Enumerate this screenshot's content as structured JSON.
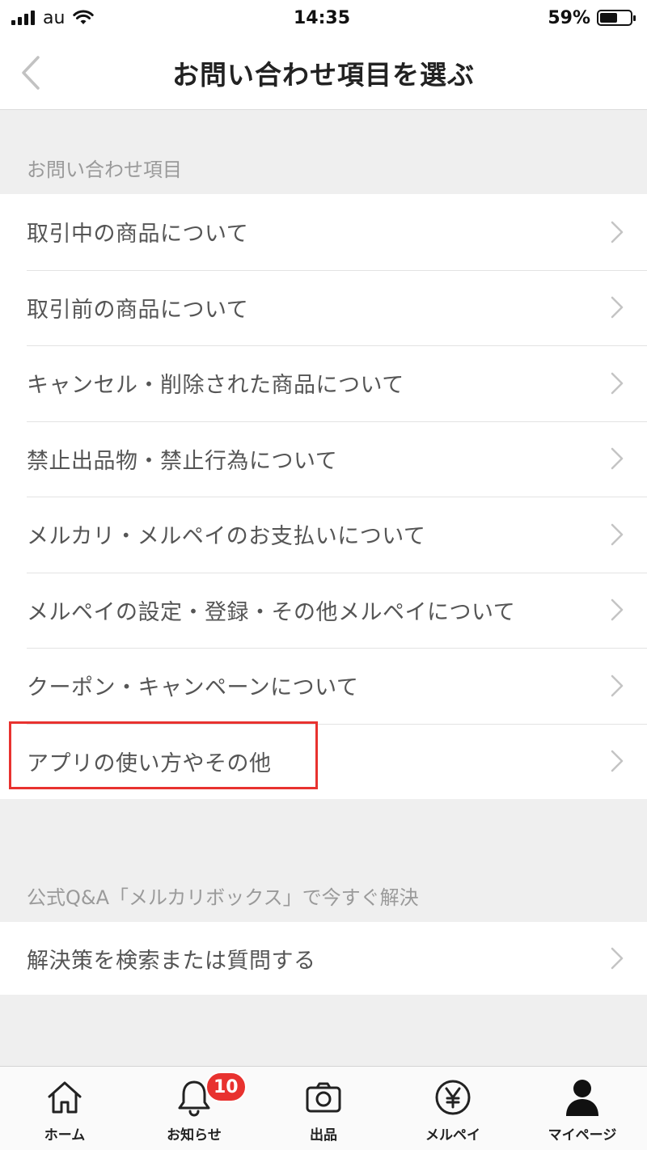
{
  "status_bar": {
    "carrier": "au",
    "time": "14:35",
    "battery": "59%",
    "battery_level": 0.59
  },
  "nav": {
    "title": "お問い合わせ項目を選ぶ",
    "back_icon": "chevron-left-icon"
  },
  "inquiry_section": {
    "header": "お問い合わせ項目",
    "items": [
      {
        "label": "取引中の商品について"
      },
      {
        "label": "取引前の商品について"
      },
      {
        "label": "キャンセル・削除された商品について"
      },
      {
        "label": "禁止出品物・禁止行為について"
      },
      {
        "label": "メルカリ・メルペイのお支払いについて"
      },
      {
        "label": "メルペイの設定・登録・その他メルペイについて"
      },
      {
        "label": "クーポン・キャンペーンについて"
      },
      {
        "label": "アプリの使い方やその他",
        "highlighted": true
      }
    ]
  },
  "qa_section": {
    "header": "公式Q&A「メルカリボックス」で今すぐ解決",
    "items": [
      {
        "label": "解決策を検索または質問する"
      }
    ]
  },
  "tab_bar": {
    "tabs": [
      {
        "label": "ホーム",
        "icon": "home-icon"
      },
      {
        "label": "お知らせ",
        "icon": "bell-icon",
        "badge": "10"
      },
      {
        "label": "出品",
        "icon": "camera-icon"
      },
      {
        "label": "メルペイ",
        "icon": "yen-coin-icon"
      },
      {
        "label": "マイページ",
        "icon": "person-icon",
        "active": true
      }
    ]
  },
  "colors": {
    "highlight_border": "#e8322f",
    "badge": "#e8322f",
    "background": "#efefef"
  }
}
